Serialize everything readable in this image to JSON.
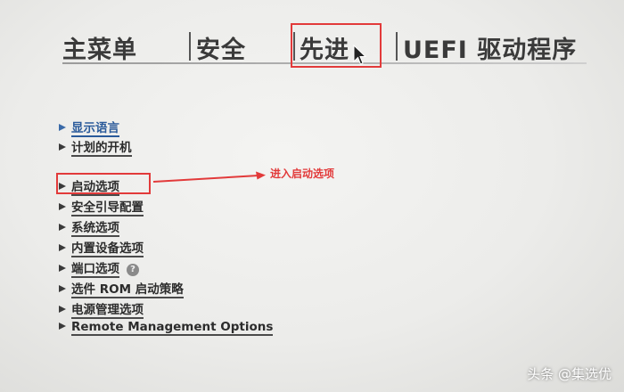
{
  "tabs": [
    {
      "label": "主菜单"
    },
    {
      "label": "安全"
    },
    {
      "label": "先进"
    },
    {
      "label": "UEFI 驱动程序"
    }
  ],
  "active_tab": "先进",
  "menu": {
    "items": [
      {
        "label": "显示语言",
        "selected": true
      },
      {
        "label": "计划的开机"
      },
      {
        "label": "启动选项"
      },
      {
        "label": "安全引导配置"
      },
      {
        "label": "系统选项"
      },
      {
        "label": "内置设备选项"
      },
      {
        "label": "端口选项",
        "help_icon": "?"
      },
      {
        "label": "选件 ROM 启动策略"
      },
      {
        "label": "电源管理选项"
      },
      {
        "label": "Remote Management Options"
      }
    ]
  },
  "annotation": {
    "text": "进入启动选项",
    "color": "#e23a3a"
  },
  "watermark": "头条 @集选优",
  "colors": {
    "highlight": "#e23a3a",
    "selected": "#2a5a9a",
    "text": "#2c2c2c"
  }
}
